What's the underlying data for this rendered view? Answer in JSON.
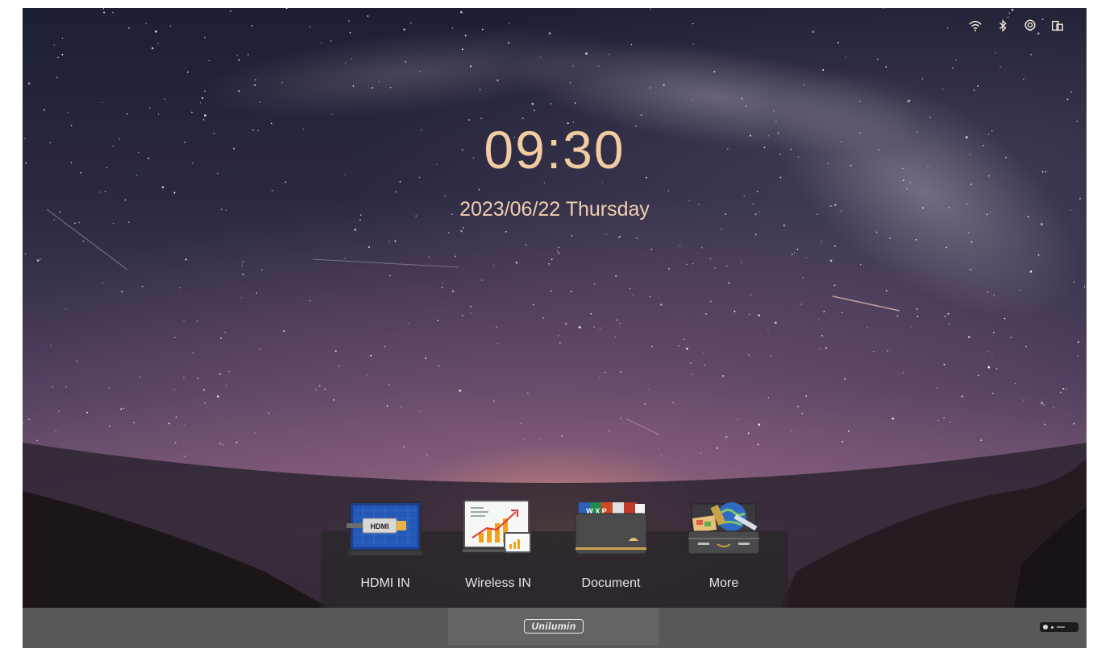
{
  "status_bar": {
    "icons": [
      "wifi-icon",
      "bluetooth-icon",
      "hotspot-icon",
      "source-icon"
    ],
    "color": "#f3e6d8"
  },
  "clock": {
    "time": "09:30",
    "date": "2023/06/22 Thursday",
    "color": "#f3cba0"
  },
  "dock": {
    "apps": [
      {
        "label": "HDMI IN",
        "icon": "hdmi-icon",
        "icon_text": "HDMI"
      },
      {
        "label": "Wireless IN",
        "icon": "wireless-chart-icon"
      },
      {
        "label": "Document",
        "icon": "document-folder-icon",
        "icon_text": "W X P"
      },
      {
        "label": "More",
        "icon": "toolbox-globe-icon"
      }
    ]
  },
  "bottom_bar": {
    "logo": "Unilumin"
  }
}
